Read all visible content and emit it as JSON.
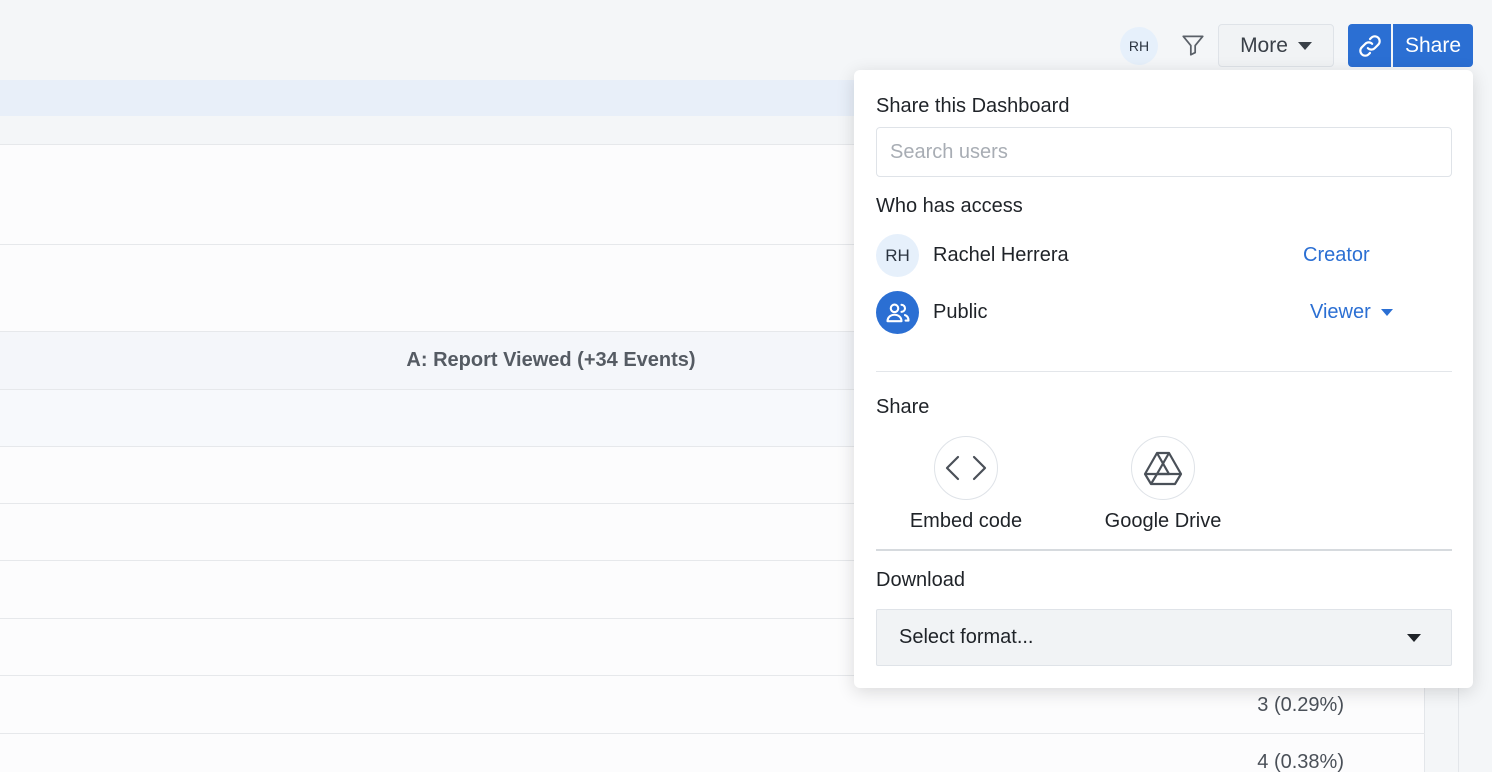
{
  "header": {
    "user_initials": "RH",
    "more_label": "More",
    "share_label": "Share"
  },
  "report": {
    "group_title": "A: Report Viewed (+34 Events)",
    "values": [
      "3 (0.29%)",
      "4 (0.38%)"
    ]
  },
  "share_popover": {
    "title": "Share this Dashboard",
    "search_placeholder": "Search users",
    "who_has_access_label": "Who has access",
    "access": [
      {
        "initials": "RH",
        "name": "Rachel Herrera",
        "role": "Creator"
      },
      {
        "icon": "users-icon",
        "name": "Public",
        "role": "Viewer"
      }
    ],
    "share_section_label": "Share",
    "share_options": [
      {
        "icon": "code-icon",
        "label": "Embed code"
      },
      {
        "icon": "google-drive-icon",
        "label": "Google Drive"
      }
    ],
    "download_label": "Download",
    "format_select_value": "Select format..."
  },
  "colors": {
    "accent": "#2b6fd3",
    "avatar_bg": "#e6f0fb"
  }
}
